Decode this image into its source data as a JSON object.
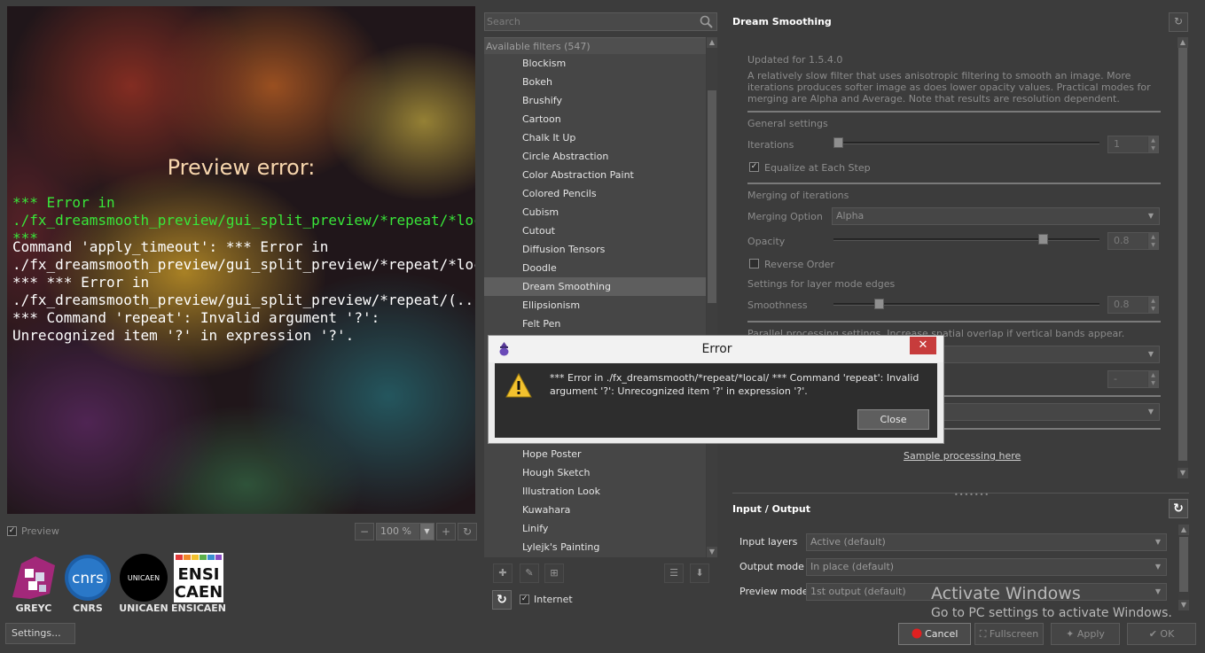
{
  "preview": {
    "title": "Preview error:",
    "error_line1": "*** Error in ./fx_dreamsmooth_preview/gui_split_preview/*repeat/*local/*local/ ***",
    "error_line2": "Command 'apply_timeout': *** Error in ./fx_dreamsmooth_preview/gui_split_preview/*repeat/*local/*local/apply_timeout/*if/*local/ *** *** Error in ./fx_dreamsmooth_preview/gui_split_preview/*repeat/(...)/_split_preview/fx_dreamsmooth/*repeat/*local/ *** Command 'repeat': Invalid argument '?': Unrecognized item '?' in expression '?'.",
    "preview_checkbox_label": "Preview",
    "zoom_value": "100 %"
  },
  "logos": [
    {
      "name": "GREYC"
    },
    {
      "name": "CNRS",
      "mark": "cnrs"
    },
    {
      "name": "UNICAEN",
      "mark": "UNICAEN"
    },
    {
      "name": "ENSICAEN",
      "mark_top": "ENSI",
      "mark_bottom": "CAEN"
    }
  ],
  "settings_button": "Settings...",
  "filters": {
    "search_placeholder": "Search",
    "header": "Available filters (547)",
    "items": [
      {
        "label": "Blockism"
      },
      {
        "label": "Bokeh"
      },
      {
        "label": "Brushify"
      },
      {
        "label": "Cartoon"
      },
      {
        "label": "Chalk It Up"
      },
      {
        "label": "Circle Abstraction"
      },
      {
        "label": "Color Abstraction Paint"
      },
      {
        "label": "Colored Pencils"
      },
      {
        "label": "Cubism"
      },
      {
        "label": "Cutout"
      },
      {
        "label": "Diffusion Tensors"
      },
      {
        "label": "Doodle"
      },
      {
        "label": "Dream Smoothing",
        "selected": true
      },
      {
        "label": "Ellipsionism"
      },
      {
        "label": "Felt Pen"
      },
      {
        "label": ""
      },
      {
        "label": ""
      },
      {
        "label": ""
      },
      {
        "label": ""
      },
      {
        "label": ""
      },
      {
        "label": ""
      },
      {
        "label": "Hope Poster"
      },
      {
        "label": "Hough Sketch"
      },
      {
        "label": "Illustration Look"
      },
      {
        "label": "Kuwahara"
      },
      {
        "label": "Linify"
      },
      {
        "label": "Lylejk's Painting"
      }
    ],
    "internet_label": "Internet"
  },
  "params": {
    "filter_title": "Dream Smoothing",
    "updated": "Updated for 1.5.4.0",
    "description": "A relatively slow filter that uses anisotropic filtering to smooth an image. More iterations produces softer image as does lower opacity values. Practical modes for merging are Alpha and Average. Note that results are resolution dependent.",
    "general_settings": "General settings",
    "iterations_label": "Iterations",
    "iterations_value": "1",
    "iterations_level": 0.0,
    "equalize_label": "Equalize at Each Step",
    "merging_header": "Merging of iterations",
    "merging_option_label": "Merging Option",
    "merging_option_value": "Alpha",
    "opacity_label": "Opacity",
    "opacity_value": "0.8",
    "opacity_level": 0.8,
    "reverse_order_label": "Reverse Order",
    "edges_header": "Settings for layer mode edges",
    "smoothness_label": "Smoothness",
    "smoothness_value": "0.8",
    "smoothness_level": 0.16,
    "parallel_header": "Parallel processing settings. Increase spatial overlap if vertical bands appear.",
    "spatial_overlap_value": "-",
    "sample_link": "Sample processing here"
  },
  "io": {
    "title": "Input / Output",
    "input_layers_label": "Input layers",
    "input_layers_value": "Active (default)",
    "output_mode_label": "Output mode",
    "output_mode_value": "In place (default)",
    "preview_mode_label": "Preview mode",
    "preview_mode_value": "1st output (default)"
  },
  "watermark": {
    "line1": "Activate Windows",
    "line2": "Go to PC settings to activate Windows."
  },
  "buttons": {
    "cancel": "Cancel",
    "fullscreen": "Fullscreen",
    "apply": "Apply",
    "ok": "OK"
  },
  "dialog": {
    "title": "Error",
    "message": "*** Error in ./fx_dreamsmooth/*repeat/*local/ *** Command 'repeat': Invalid argument '?': Unrecognized item '?' in expression '?'.",
    "close_button": "Close"
  },
  "colors": {
    "background": "#3c3c3c",
    "list_background": "#464646",
    "selected_row": "#5e5e5e",
    "error_green": "#39e639",
    "preview_title": "#f7d6ad",
    "dialog_close": "#c73c3c",
    "cancel_icon": "#e02020"
  }
}
